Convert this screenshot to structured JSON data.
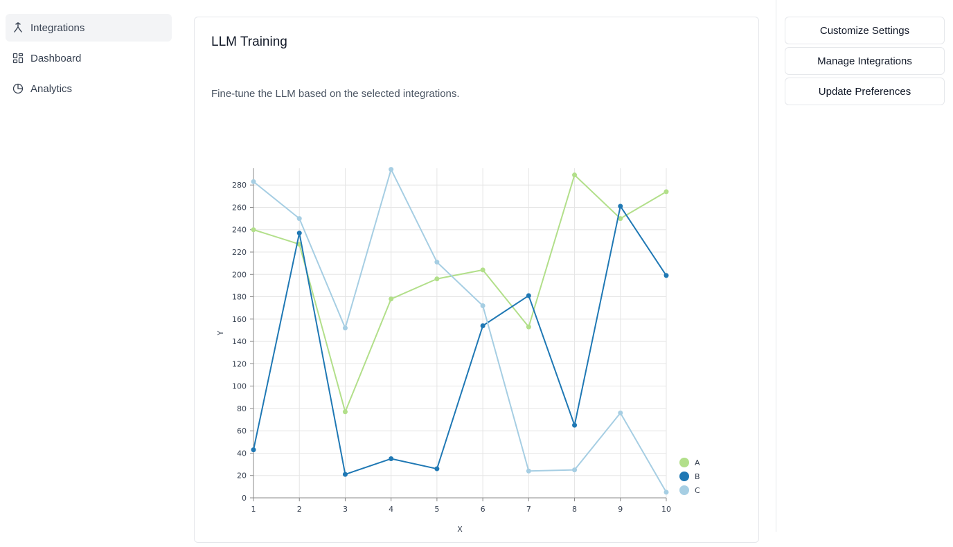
{
  "sidebar": {
    "items": [
      {
        "label": "Integrations",
        "icon": "merge-icon",
        "active": true
      },
      {
        "label": "Dashboard",
        "icon": "grid-icon",
        "active": false
      },
      {
        "label": "Analytics",
        "icon": "pie-chart-icon",
        "active": false
      }
    ]
  },
  "main": {
    "title": "LLM Training",
    "description": "Fine-tune the LLM based on the selected integrations."
  },
  "actions": {
    "customize_label": "Customize Settings",
    "manage_label": "Manage Integrations",
    "update_label": "Update Preferences"
  },
  "chart_data": {
    "type": "line",
    "xlabel": "X",
    "ylabel": "Y",
    "x": [
      1,
      2,
      3,
      4,
      5,
      6,
      7,
      8,
      9,
      10
    ],
    "xlim": [
      1,
      10
    ],
    "ylim": [
      0,
      295
    ],
    "yticks": [
      0,
      20,
      40,
      60,
      80,
      100,
      120,
      140,
      160,
      180,
      200,
      220,
      240,
      260,
      280
    ],
    "grid": true,
    "legend_position": "bottom-right",
    "series": [
      {
        "name": "A",
        "color": "#b2df8a",
        "values": [
          240,
          227,
          77,
          178,
          196,
          204,
          153,
          289,
          250,
          274
        ]
      },
      {
        "name": "B",
        "color": "#1f78b4",
        "values": [
          43,
          237,
          21,
          35,
          26,
          154,
          181,
          65,
          261,
          199
        ]
      },
      {
        "name": "C",
        "color": "#a6cee3",
        "values": [
          283,
          250,
          152,
          294,
          211,
          172,
          24,
          25,
          76,
          5
        ]
      }
    ]
  }
}
